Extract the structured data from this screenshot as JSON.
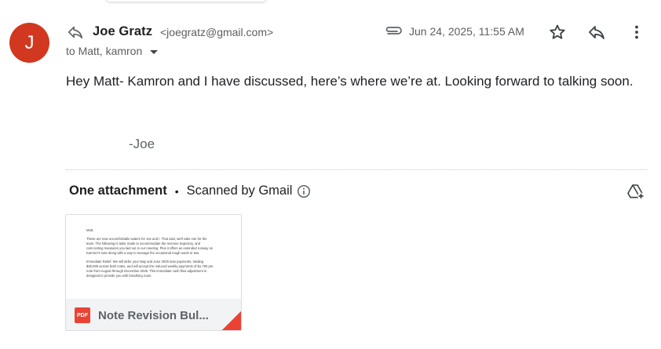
{
  "sender": {
    "avatar_letter": "J",
    "avatar_color": "#d1381f",
    "name": "Joe Gratz",
    "email": "<joegratz@gmail.com>"
  },
  "recipients": "to Matt, kamron",
  "date": "Jun 24, 2025, 11:55 AM",
  "body": {
    "text": "Hey Matt- Kamron and I have discussed, here’s where we’re at. Looking forward to talking soon.",
    "signature": "-Joe"
  },
  "attachments": {
    "count_label": "One attachment",
    "separator": "•",
    "scan_label": "Scanned by Gmail",
    "file": {
      "type_badge": "PDF",
      "name": "Note Revision Bul...",
      "preview_lines": [
        "Matt,",
        "These are new uncomfortable waters for Joe and I. That said, we'll take one for the",
        "team. The following is tailor made to accommodate the revenue trajectory, and",
        "cost-cutting measures you laid out in our meeting. Plus it offers an extended runway on",
        "Kamron's note along with a way to manage the occasional rough week or two.",
        "Immediate Relief: We will defer your May and June 2025 loan payments, totaling",
        "$30,000 across both notes, and will accept the reduced weekly payments of $1,750 per",
        "note from August through December 2025. This immediate cash flow adjustment is",
        "designed to provide you with breathing room."
      ]
    }
  },
  "icons": {
    "reply_small": "reply-arrow-icon",
    "attachment": "paperclip-icon",
    "star": "star-outline-icon",
    "reply": "reply-icon",
    "more": "more-vert-icon",
    "info": "info-circle-icon",
    "drive": "add-to-drive-icon"
  }
}
